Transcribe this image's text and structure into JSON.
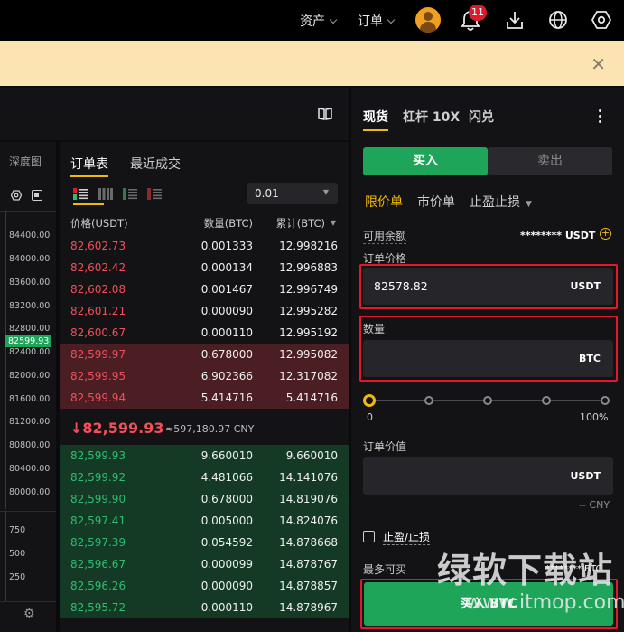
{
  "nav": {
    "assets": "资产",
    "orders": "订单",
    "notif_count": "11"
  },
  "left": {
    "depth_tab": "深度图",
    "prices": [
      "84400.00",
      "84000.00",
      "83600.00",
      "83200.00",
      "82800.00",
      "82400.00",
      "82000.00",
      "81600.00",
      "81200.00",
      "80800.00",
      "80400.00",
      "80000.00"
    ],
    "current_price": "82599.93",
    "volumes": [
      "750",
      "500",
      "250"
    ]
  },
  "book": {
    "tab_book": "订单表",
    "tab_trades": "最近成交",
    "precision": "0.01",
    "col_price": "价格(USDT)",
    "col_qty": "数量(BTC)",
    "col_total": "累计(BTC)",
    "asks": [
      {
        "price": "82,602.73",
        "qty": "0.001333",
        "total": "12.998216"
      },
      {
        "price": "82,602.42",
        "qty": "0.000134",
        "total": "12.996883"
      },
      {
        "price": "82,602.08",
        "qty": "0.001467",
        "total": "12.996749"
      },
      {
        "price": "82,601.21",
        "qty": "0.000090",
        "total": "12.995282"
      },
      {
        "price": "82,600.67",
        "qty": "0.000110",
        "total": "12.995192"
      },
      {
        "price": "82,599.97",
        "qty": "0.678000",
        "total": "12.995082"
      },
      {
        "price": "82,599.95",
        "qty": "6.902366",
        "total": "12.317082"
      },
      {
        "price": "82,599.94",
        "qty": "5.414716",
        "total": "5.414716"
      }
    ],
    "last_price": "82,599.93",
    "last_cny": "≈597,180.97 CNY",
    "bids": [
      {
        "price": "82,599.93",
        "qty": "9.660010",
        "total": "9.660010"
      },
      {
        "price": "82,599.92",
        "qty": "4.481066",
        "total": "14.141076"
      },
      {
        "price": "82,599.90",
        "qty": "0.678000",
        "total": "14.819076"
      },
      {
        "price": "82,597.41",
        "qty": "0.005000",
        "total": "14.824076"
      },
      {
        "price": "82,597.39",
        "qty": "0.054592",
        "total": "14.878668"
      },
      {
        "price": "82,596.67",
        "qty": "0.000099",
        "total": "14.878767"
      },
      {
        "price": "82,596.26",
        "qty": "0.000090",
        "total": "14.878857"
      },
      {
        "price": "82,595.72",
        "qty": "0.000110",
        "total": "14.878967"
      }
    ]
  },
  "trade": {
    "tab_spot": "现货",
    "tab_margin": "杠杆 10X",
    "tab_flash": "闪兑",
    "buy": "买入",
    "sell": "卖出",
    "type_limit": "限价单",
    "type_market": "市价单",
    "type_stop": "止盈止损",
    "avail_label": "可用余额",
    "avail_value": "******** USDT",
    "price_label": "订单价格",
    "price_value": "82578.82",
    "price_unit": "USDT",
    "qty_label": "数量",
    "qty_unit": "BTC",
    "pct_min": "0",
    "pct_max": "100%",
    "value_label": "订单价值",
    "value_unit": "USDT",
    "value_cny": "-- CNY",
    "tpsl_label": "止盈/止损",
    "max_label": "最多可买",
    "max_value": "******** BTC",
    "submit": "买入 BTC"
  },
  "watermark": {
    "title": "绿软下载站",
    "url": "www.itmop.com"
  }
}
